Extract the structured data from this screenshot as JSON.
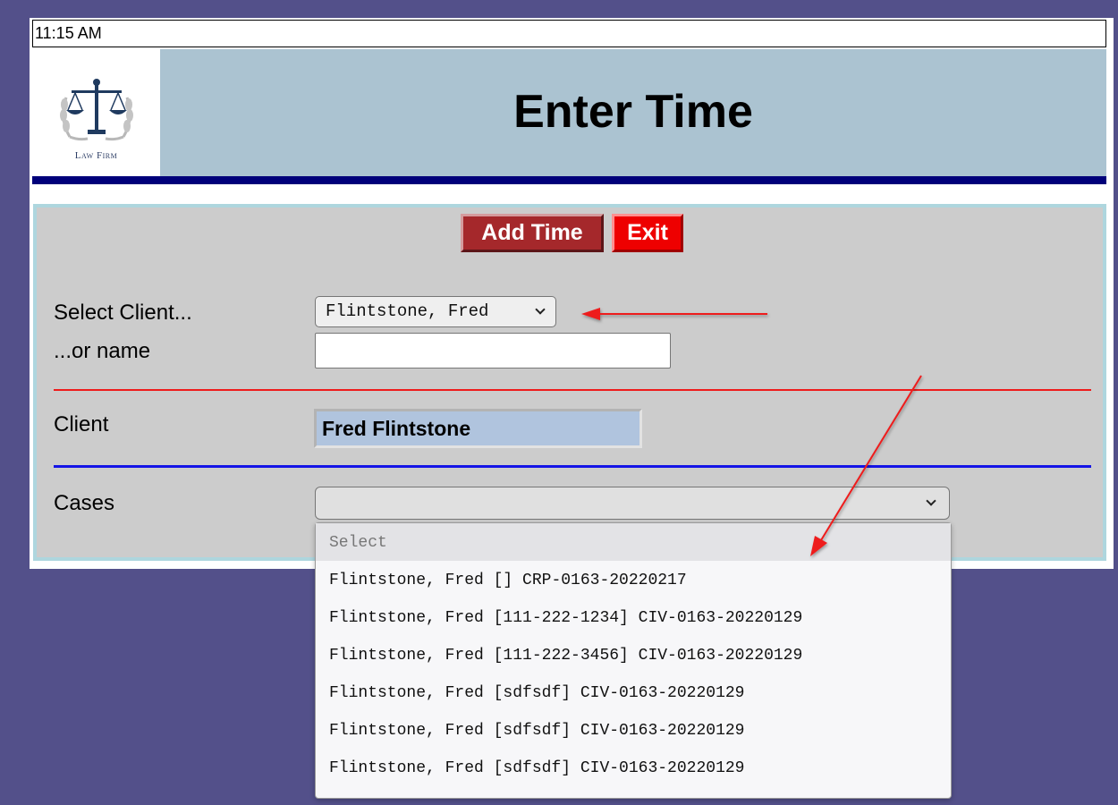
{
  "clock": "11:15 AM",
  "header": {
    "logo_text": "Law Firm",
    "title": "Enter Time"
  },
  "toolbar": {
    "add_time_label": "Add Time",
    "exit_label": "Exit"
  },
  "form": {
    "select_client_label": "Select Client...",
    "or_name_label": "...or name",
    "select_client_value": "Flintstone, Fred",
    "name_input_value": "",
    "client_label": "Client",
    "client_value": "Fred Flintstone",
    "cases_label": "Cases",
    "cases_value": ""
  },
  "cases_dropdown": {
    "placeholder_option": "Select",
    "options": [
      "Flintstone, Fred [] CRP-0163-20220217",
      "Flintstone, Fred [111-222-1234] CIV-0163-20220129",
      "Flintstone, Fred [111-222-3456] CIV-0163-20220129",
      "Flintstone, Fred [sdfsdf] CIV-0163-20220129",
      "Flintstone, Fred [sdfsdf] CIV-0163-20220129",
      "Flintstone, Fred [sdfsdf] CIV-0163-20220129"
    ]
  },
  "colors": {
    "background": "#53508a",
    "header_band": "#abc3d1",
    "header_rule": "#00007a",
    "panel": "#cccccc",
    "add_time_button": "#a5282b",
    "exit_button": "#ee0000",
    "client_box": "#b0c4de",
    "annotation_arrow": "#ee1c1c"
  },
  "icons": {
    "logo": "scales-of-justice-icon",
    "dropdown": "chevron-down-icon"
  }
}
